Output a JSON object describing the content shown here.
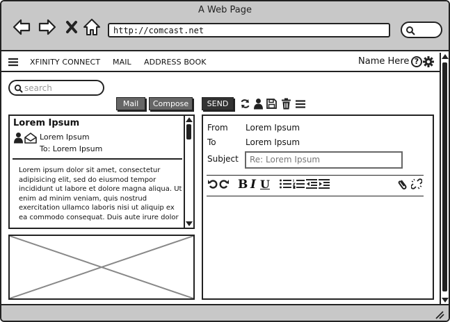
{
  "browser": {
    "title": "A Web Page",
    "url": "http://comcast.net"
  },
  "header": {
    "nav": [
      "XFINITY CONNECT",
      "MAIL",
      "ADDRESS BOOK"
    ],
    "user_name": "Name Here",
    "help_glyph": "?"
  },
  "search": {
    "placeholder": "search"
  },
  "toolbar": {
    "mail_label": "Mail",
    "compose_label": "Compose",
    "send_label": "SEND",
    "icons": [
      "refresh-icon",
      "contact-icon",
      "save-icon",
      "trash-icon",
      "menu-icon"
    ]
  },
  "message": {
    "title": "Lorem Ipsum",
    "from": "Lorem Ipsum",
    "to": "To: Lorem Ipsum",
    "body": "Lorem ipsum dolor sit amet, consectetur adipisicing elit, sed do eiusmod tempor incididunt ut labore et dolore magna aliqua. Ut enim ad minim veniam, quis nostrud exercitation ullamco laboris nisi ut aliquip ex ea commodo consequat. Duis aute irure dolor"
  },
  "compose": {
    "from_label": "From",
    "from_value": "Lorem Ipsum",
    "to_label": "To",
    "to_value": "Lorem Ipsum",
    "subject_label": "Subject",
    "subject_value": "Re: Lorem Ipsum",
    "format": {
      "bold": "B",
      "italic": "I",
      "underline": "U"
    }
  }
}
